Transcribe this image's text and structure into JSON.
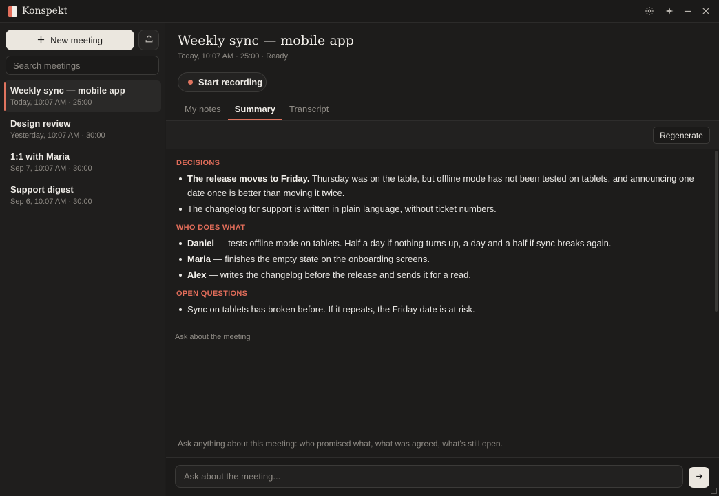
{
  "app": {
    "title": "Konspekt"
  },
  "sidebar": {
    "new_meeting_label": "New meeting",
    "search_placeholder": "Search meetings",
    "meetings": [
      {
        "title": "Weekly sync — mobile app",
        "meta": "Today, 10:07 AM · 25:00",
        "active": true
      },
      {
        "title": "Design review",
        "meta": "Yesterday, 10:07 AM · 30:00",
        "active": false
      },
      {
        "title": "1:1 with Maria",
        "meta": "Sep 7, 10:07 AM · 30:00",
        "active": false
      },
      {
        "title": "Support digest",
        "meta": "Sep 6, 10:07 AM · 30:00",
        "active": false
      }
    ]
  },
  "main": {
    "title": "Weekly sync — mobile app",
    "subtitle": "Today, 10:07 AM · 25:00 · Ready",
    "record_label": "Start recording",
    "tabs": [
      {
        "label": "My notes",
        "active": false
      },
      {
        "label": "Summary",
        "active": true
      },
      {
        "label": "Transcript",
        "active": false
      }
    ],
    "regenerate_label": "Regenerate"
  },
  "summary": {
    "decisions": {
      "heading": "DECISIONS",
      "items": [
        {
          "bold": "The release moves to Friday.",
          "text": " Thursday was on the table, but offline mode has not been tested on tablets, and announcing one date once is better than moving it twice."
        },
        {
          "bold": "",
          "text": "The changelog for support is written in plain language, without ticket numbers."
        }
      ]
    },
    "who": {
      "heading": "WHO DOES WHAT",
      "items": [
        {
          "bold": "Daniel",
          "text": " — tests offline mode on tablets. Half a day if nothing turns up, a day and a half if sync breaks again."
        },
        {
          "bold": "Maria",
          "text": " — finishes the empty state on the onboarding screens."
        },
        {
          "bold": "Alex",
          "text": " — writes the changelog before the release and sends it for a read."
        }
      ]
    },
    "open": {
      "heading": "OPEN QUESTIONS",
      "items": [
        {
          "bold": "",
          "text": "Sync on tablets has broken before. If it repeats, the Friday date is at risk."
        }
      ]
    }
  },
  "chat": {
    "label": "Ask about the meeting",
    "hint": "Ask anything about this meeting: who promised what, what was agreed, what's still open.",
    "input_placeholder": "Ask about the meeting..."
  },
  "colors": {
    "accent": "#e0745f",
    "background": "#1d1c1b",
    "sidebar": "#1f1e1d"
  },
  "icons": {
    "settings": "gear-icon",
    "sparkle": "sparkle-icon",
    "minimize": "minimize-icon",
    "close": "close-icon",
    "plus": "plus-icon",
    "export": "upload-icon",
    "send": "arrow-right-icon"
  }
}
